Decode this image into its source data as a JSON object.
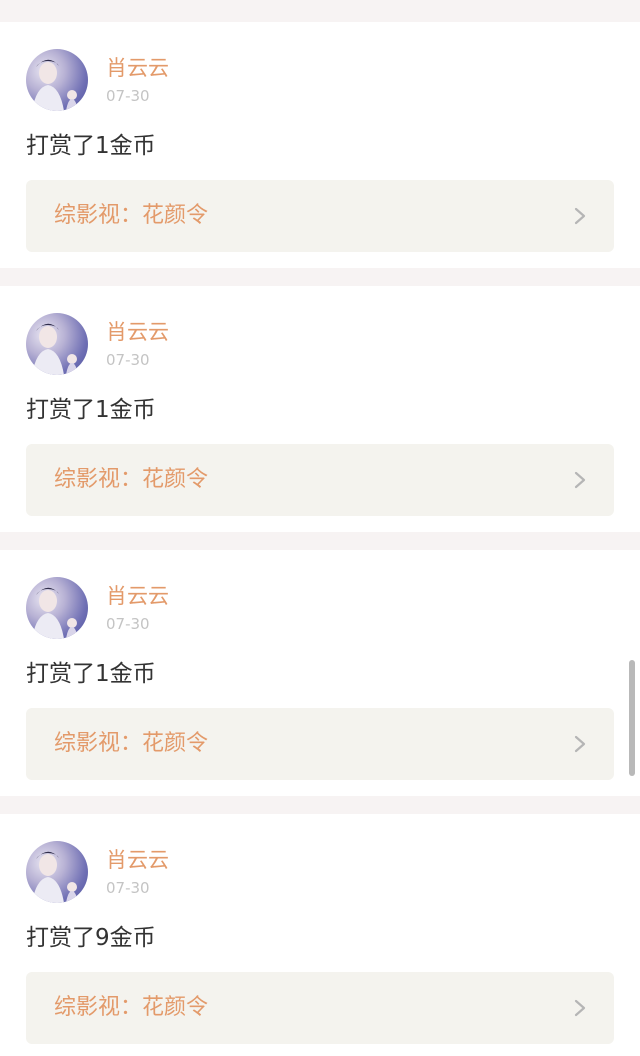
{
  "feed": {
    "items": [
      {
        "user": "肖云云",
        "date": "07-30",
        "action": "打赏了1金币",
        "link": "综影视：花颜令"
      },
      {
        "user": "肖云云",
        "date": "07-30",
        "action": "打赏了1金币",
        "link": "综影视：花颜令"
      },
      {
        "user": "肖云云",
        "date": "07-30",
        "action": "打赏了1金币",
        "link": "综影视：花颜令"
      },
      {
        "user": "肖云云",
        "date": "07-30",
        "action": "打赏了9金币",
        "link": "综影视：花颜令"
      }
    ]
  },
  "icons": {
    "chevron": "chevron-right-icon",
    "avatar": "user-avatar"
  },
  "colors": {
    "accent": "#e39a6a",
    "text": "#333333",
    "date": "#c4c4c4",
    "link_bg": "#f4f3ee",
    "separator": "#f7f3f3"
  }
}
